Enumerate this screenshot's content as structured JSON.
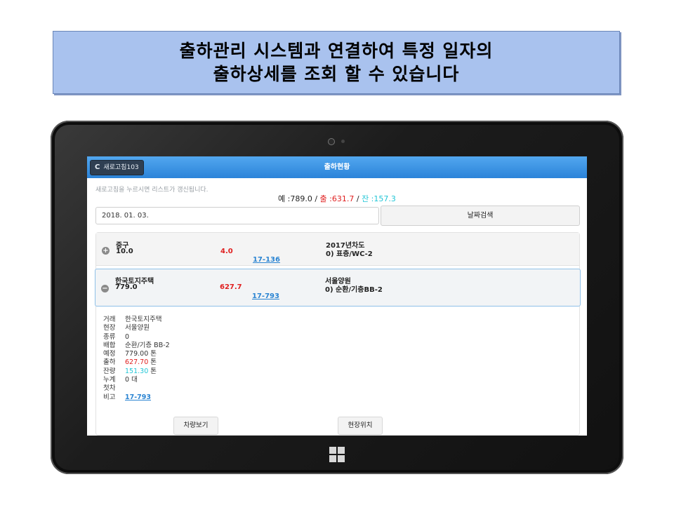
{
  "banner": {
    "line1": "출하관리 시스템과 연결하여 특정 일자의",
    "line2": "출하상세를 조회 할 수 있습니다"
  },
  "app": {
    "refresh_label": "새로고침103",
    "title": "출하현황",
    "hint": "새로고침을 누르시면 리스트가 갱신됩니다.",
    "summary": {
      "planned": "예 :789.0",
      "sep1": " / ",
      "shipped": "출 :631.7",
      "sep2": " / ",
      "remaining": "잔 :157.3"
    },
    "date_value": "2018. 01. 03.",
    "search_label": "날짜검색"
  },
  "list": [
    {
      "client": "중구",
      "planned": "10.0",
      "shipped": "4.0",
      "site": "2017년차도",
      "mix": "0) 표층/WC-2",
      "code": "17-136"
    },
    {
      "client": "한국토지주택",
      "planned": "779.0",
      "shipped": "627.7",
      "site": "서울양원",
      "mix": "0) 순환/기층BB-2",
      "code": "17-793"
    }
  ],
  "details": {
    "labels": [
      "거래",
      "현장",
      "종류",
      "배합",
      "예정",
      "출하",
      "잔량",
      "누계",
      "첫차",
      "비고"
    ],
    "client": "한국토지주택",
    "site": "서울양원",
    "kind": "0",
    "mix": "순환/기층 BB-2",
    "planned": "779.00",
    "shipped": "627.70",
    "remaining": "151.30",
    "cumulative": "0",
    "first_truck": "",
    "note": "17-793",
    "unit_ton": " 톤",
    "unit_truck": " 대"
  },
  "buttons": {
    "vehicle": "차량보기",
    "location": "현장위치"
  },
  "colors": {
    "title_bar": "#2b83d9",
    "shipped": "#e02020",
    "remaining": "#21c6d6",
    "link": "#2a84d2",
    "banner": "#a9c2ee"
  }
}
